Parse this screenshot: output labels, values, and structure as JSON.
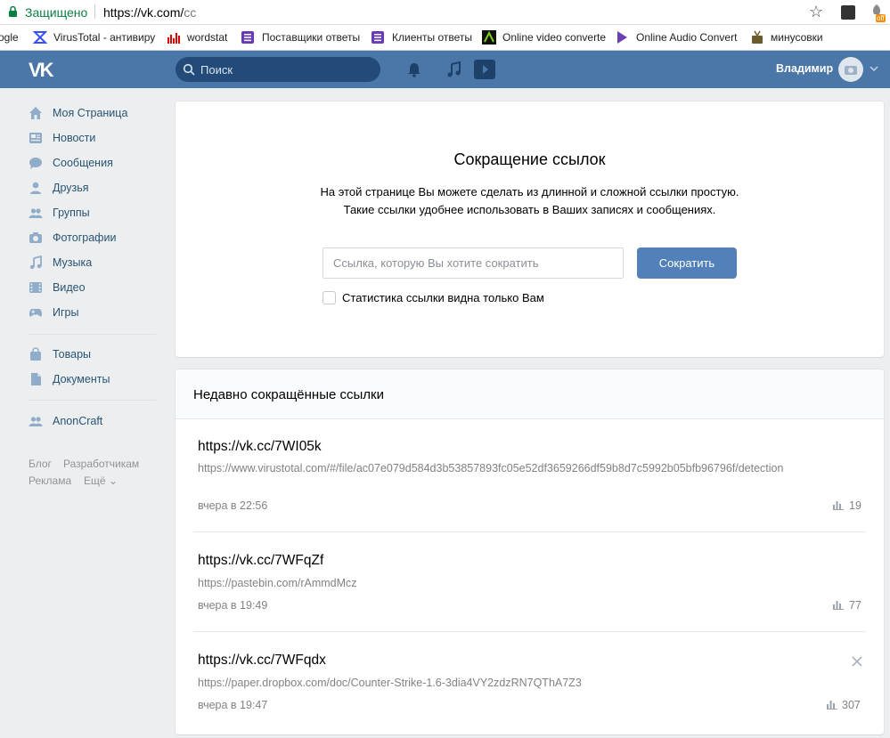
{
  "browser": {
    "secure_label": "Защищено",
    "url_host": "https://vk.com/",
    "url_path": "cc",
    "ext_badge": "off",
    "bookmarks": [
      {
        "label": "ogle"
      },
      {
        "label": "VirusTotal - антивиру"
      },
      {
        "label": "wordstat"
      },
      {
        "label": "Поставщики ответы"
      },
      {
        "label": "Клиенты ответы"
      },
      {
        "label": "Online video converte"
      },
      {
        "label": "Online Audio Convert"
      },
      {
        "label": "минусовки"
      }
    ]
  },
  "header": {
    "logo": "VK",
    "search_placeholder": "Поиск",
    "user_name": "Владимир"
  },
  "sidebar": {
    "items": [
      {
        "label": "Моя Страница",
        "icon": "home-icon"
      },
      {
        "label": "Новости",
        "icon": "news-icon"
      },
      {
        "label": "Сообщения",
        "icon": "messages-icon"
      },
      {
        "label": "Друзья",
        "icon": "friends-icon"
      },
      {
        "label": "Группы",
        "icon": "groups-icon"
      },
      {
        "label": "Фотографии",
        "icon": "photos-icon"
      },
      {
        "label": "Музыка",
        "icon": "music-icon"
      },
      {
        "label": "Видео",
        "icon": "video-icon"
      },
      {
        "label": "Игры",
        "icon": "games-icon"
      },
      {
        "label": "Товары",
        "icon": "goods-icon"
      },
      {
        "label": "Документы",
        "icon": "documents-icon"
      },
      {
        "label": "AnonCraft",
        "icon": "community-icon"
      }
    ],
    "footer": {
      "blog": "Блог",
      "developers": "Разработчикам",
      "ads": "Реклама",
      "more": "Ещё ⌄"
    }
  },
  "shortener": {
    "title": "Сокращение ссылок",
    "desc_line1": "На этой странице Вы можете сделать из длинной и сложной ссылки простую.",
    "desc_line2": "Такие ссылки удобнее использовать в Ваших записях и сообщениях.",
    "input_placeholder": "Ссылка, которую Вы хотите сократить",
    "button_label": "Сократить",
    "checkbox_label": "Статистика ссылки видна только Вам"
  },
  "recent": {
    "title": "Недавно сокращённые ссылки",
    "links": [
      {
        "short": "https://vk.cc/7WI05k",
        "long": "https://www.virustotal.com/#/file/ac07e079d584d3b53857893fc05e52df3659266df59b8d7c5992b05bfb96796f/detection",
        "time": "вчера в 22:56",
        "views": "19"
      },
      {
        "short": "https://vk.cc/7WFqZf",
        "long": "https://pastebin.com/rAmmdMcz",
        "time": "вчера в 19:49",
        "views": "77"
      },
      {
        "short": "https://vk.cc/7WFqdx",
        "long": "https://paper.dropbox.com/doc/Counter-Strike-1.6-3dia4VY2zdzRN7QThA7Z3",
        "time": "вчера в 19:47",
        "views": "307"
      }
    ]
  },
  "colors": {
    "header_bg": "#4a76a8",
    "button_bg": "#5181b8",
    "link_color": "#285473",
    "secure_green": "#0b8043"
  }
}
